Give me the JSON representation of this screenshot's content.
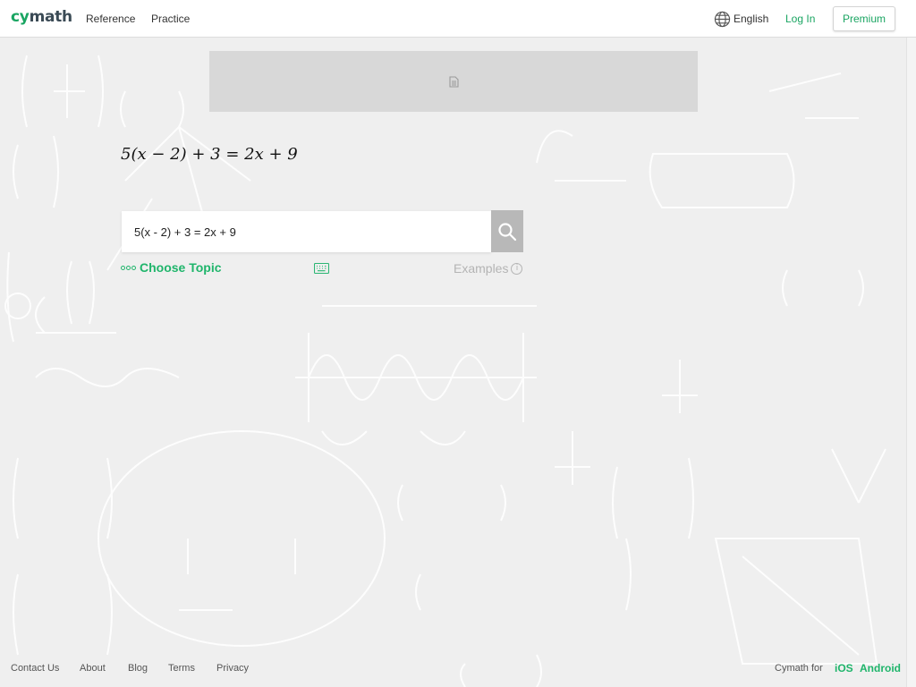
{
  "header": {
    "logo_prefix": "cy",
    "logo_suffix": "math",
    "nav": [
      "Reference",
      "Practice"
    ],
    "language_label": "English",
    "login_label": "Log In",
    "premium_label": "Premium"
  },
  "main": {
    "math_preview": "5(x − 2) + 3 = 2x + 9",
    "search": {
      "value": "5(x - 2) + 3 = 2x + 9",
      "button_icon": "search-icon"
    },
    "choose_topic_label": "Choose Topic",
    "keyboard_icon": "keyboard-icon",
    "examples_label": "Examples",
    "examples_info_glyph": "i"
  },
  "footer": {
    "links": [
      "Contact Us",
      "About",
      "Blog",
      "Terms",
      "Privacy"
    ],
    "app_label": "Cymath for",
    "stores": [
      "iOS",
      "Android"
    ]
  },
  "colors": {
    "brand_green": "#1aa562",
    "background": "#efefef",
    "ad_placeholder": "#d8d8d8",
    "search_button": "#b8b8b8"
  }
}
